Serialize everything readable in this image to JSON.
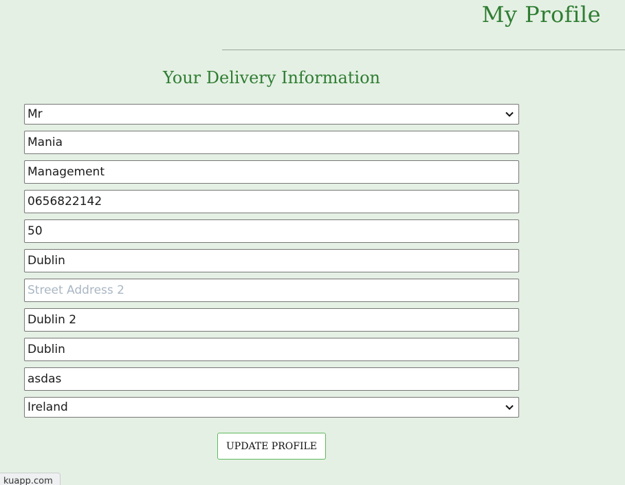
{
  "header": {
    "title": "My Profile"
  },
  "section": {
    "title": "Your Delivery Information"
  },
  "form": {
    "title_select": {
      "value": "Mr"
    },
    "first_name": {
      "value": "Mania",
      "placeholder": ""
    },
    "last_name": {
      "value": "Management",
      "placeholder": ""
    },
    "phone": {
      "value": "0656822142",
      "placeholder": ""
    },
    "street_address_1": {
      "value": "50",
      "placeholder": ""
    },
    "street_address_2_line": {
      "value": "Dublin",
      "placeholder": ""
    },
    "street_address_2": {
      "value": "",
      "placeholder": "Street Address 2"
    },
    "town": {
      "value": "Dublin 2",
      "placeholder": ""
    },
    "county": {
      "value": "Dublin",
      "placeholder": ""
    },
    "postcode": {
      "value": "asdas",
      "placeholder": ""
    },
    "country_select": {
      "value": "Ireland"
    },
    "submit_label": "UPDATE PROFILE"
  },
  "status_bar": {
    "text": "kuapp.com"
  },
  "icons": {
    "select_arrow": "chevron-down-icon"
  }
}
